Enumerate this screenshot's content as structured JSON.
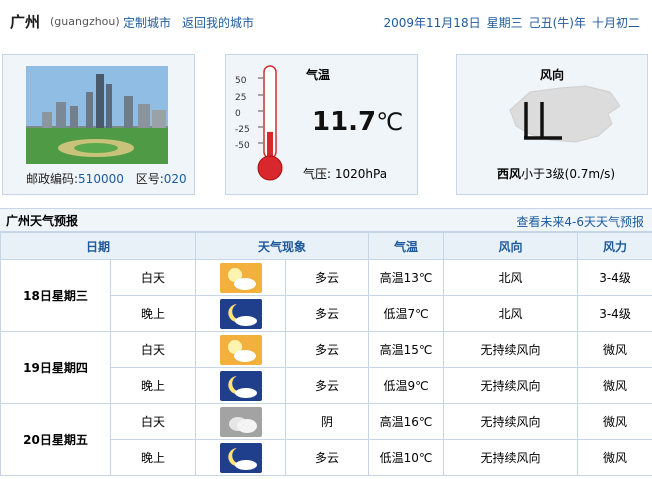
{
  "header": {
    "city": "广州",
    "pinyin": "(guangzhou)",
    "link_custom": "定制城市",
    "link_back": "返回我的城市",
    "date": "2009年11月18日",
    "weekday": "星期三",
    "ganzhi": "己丑(牛)年",
    "lunar": "十月初二"
  },
  "location": {
    "postcode_label": "邮政编码:",
    "postcode": "510000",
    "areacode_label": "区号:",
    "areacode": "020"
  },
  "current": {
    "temp_label": "气温",
    "temp_value": "11.7",
    "temp_unit": "℃",
    "pressure": "气压: 1020hPa",
    "thermo_fill_fraction": 0.24,
    "scale": [
      "50",
      "25",
      "0",
      "-25",
      "-50"
    ]
  },
  "wind": {
    "label": "风向",
    "dir_strong": "西风",
    "desc": "小于3级(0.7m/s)"
  },
  "forecast": {
    "title": "广州天气预报",
    "more_link": "查看未来4-6天天气预报",
    "columns": [
      "日期",
      "天气现象",
      "气温",
      "风向",
      "风力"
    ],
    "days": [
      {
        "date": "18日星期三",
        "rows": [
          {
            "period": "白天",
            "icon": "partly-cloudy-day-icon",
            "weather": "多云",
            "temp": "高温13℃",
            "wind_dir": "北风",
            "wind_power": "3-4级"
          },
          {
            "period": "晚上",
            "icon": "partly-cloudy-night-icon",
            "weather": "多云",
            "temp": "低温7℃",
            "wind_dir": "北风",
            "wind_power": "3-4级"
          }
        ]
      },
      {
        "date": "19日星期四",
        "rows": [
          {
            "period": "白天",
            "icon": "partly-cloudy-day-icon",
            "weather": "多云",
            "temp": "高温15℃",
            "wind_dir": "无持续风向",
            "wind_power": "微风"
          },
          {
            "period": "晚上",
            "icon": "partly-cloudy-night-icon",
            "weather": "多云",
            "temp": "低温9℃",
            "wind_dir": "无持续风向",
            "wind_power": "微风"
          }
        ]
      },
      {
        "date": "20日星期五",
        "rows": [
          {
            "period": "白天",
            "icon": "overcast-icon",
            "weather": "阴",
            "temp": "高温16℃",
            "wind_dir": "无持续风向",
            "wind_power": "微风"
          },
          {
            "period": "晚上",
            "icon": "partly-cloudy-night-icon",
            "weather": "多云",
            "temp": "低温10℃",
            "wind_dir": "无持续风向",
            "wind_power": "微风"
          }
        ]
      }
    ]
  }
}
